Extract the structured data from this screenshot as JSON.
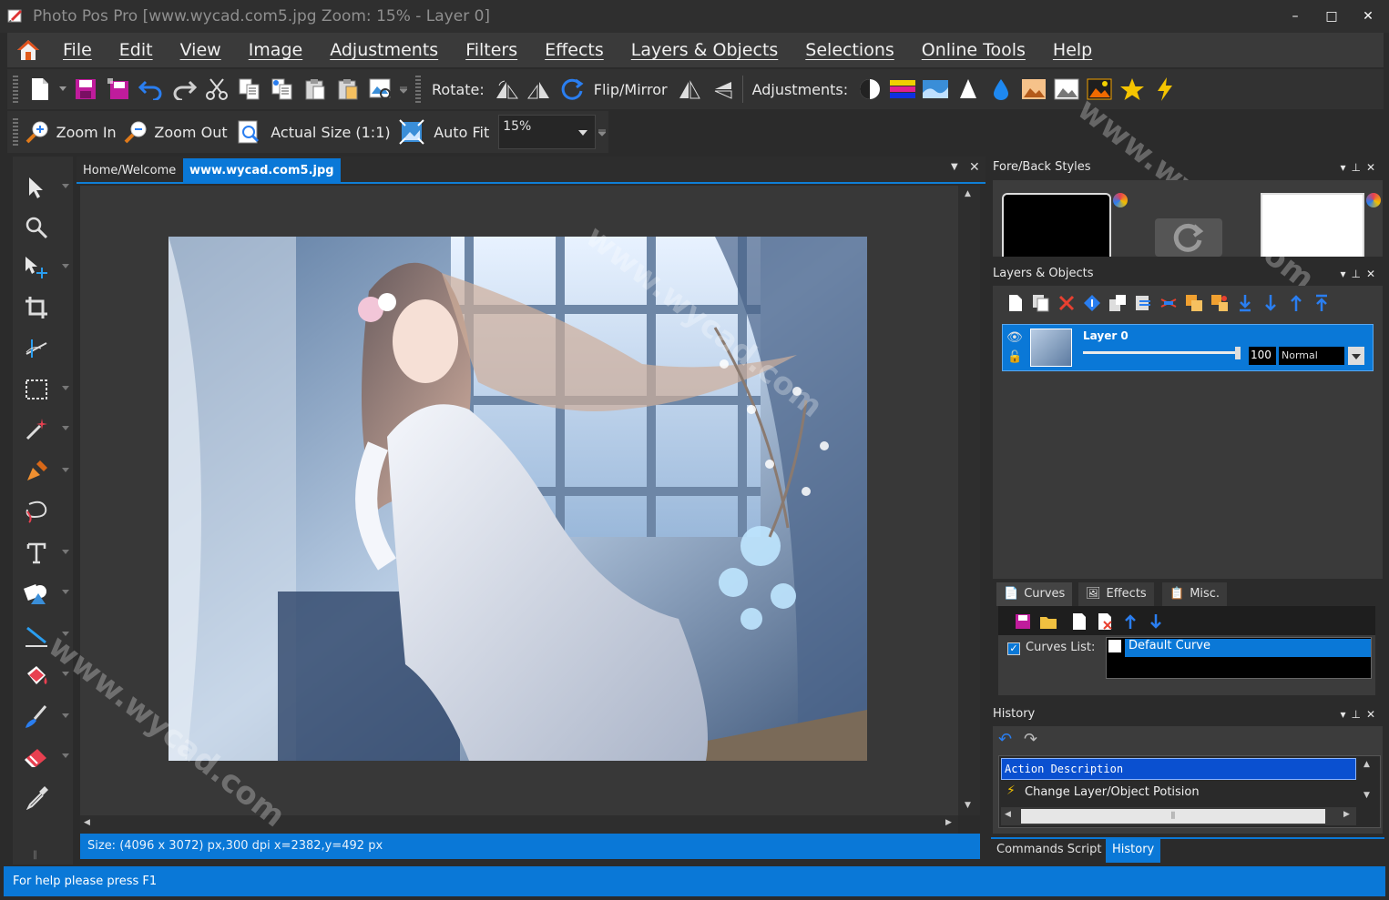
{
  "window": {
    "title": "Photo Pos Pro [www.wycad.com5.jpg Zoom: 15% - Layer 0]",
    "minimize": "–",
    "maximize": "□",
    "close": "✕"
  },
  "menu": {
    "items": [
      "File",
      "Edit",
      "View",
      "Image",
      "Adjustments",
      "Filters",
      "Effects",
      "Layers & Objects",
      "Selections",
      "Online Tools",
      "Help"
    ]
  },
  "toolbar1": {
    "rotate_label": "Rotate:",
    "flip_label": "Flip/Mirror",
    "adjustments_label": "Adjustments:"
  },
  "toolbar2": {
    "zoom_in": "Zoom In",
    "zoom_out": "Zoom Out",
    "actual_size": "Actual Size (1:1)",
    "auto_fit": "Auto Fit",
    "zoom_value": "15%"
  },
  "doc_tabs": {
    "home": "Home/Welcome",
    "active": "www.wycad.com5.jpg"
  },
  "status": {
    "image_info": "Size: (4096 x 3072) px,300 dpi   x=2382,y=492 px",
    "help": "For help please press F1"
  },
  "panels": {
    "fore_back": {
      "title": "Fore/Back Styles"
    },
    "layers": {
      "title": "Layers & Objects",
      "layer_name": "Layer 0",
      "opacity": "100",
      "blend_mode": "Normal"
    },
    "sub_tabs": {
      "curves": "Curves",
      "effects": "Effects",
      "misc": "Misc."
    },
    "curves": {
      "list_label": "Curves List:",
      "selected": "Default Curve"
    },
    "history": {
      "title": "History",
      "header": "Action Description",
      "item": "Change Layer/Object Potision"
    },
    "bottom_tabs": {
      "commands": "Commands Script",
      "history": "History"
    }
  },
  "watermark": "www.wycad.com",
  "colors": {
    "accent": "#0a78d7",
    "panel": "#3c3c3c",
    "background": "#2b2b2b"
  }
}
